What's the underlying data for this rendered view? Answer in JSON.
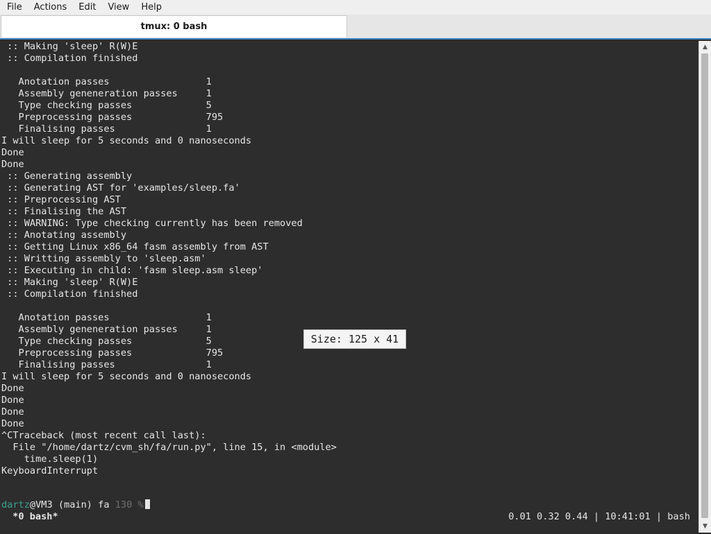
{
  "menu": [
    "File",
    "Actions",
    "Edit",
    "View",
    "Help"
  ],
  "tab": {
    "title": "tmux: 0 bash"
  },
  "terminal": {
    "lines": [
      " :: Making 'sleep' R(W)E",
      " :: Compilation finished",
      "",
      "   Anotation passes                 1",
      "   Assembly geneneration passes     1",
      "   Type checking passes             5",
      "   Preprocessing passes             795",
      "   Finalising passes                1",
      "I will sleep for 5 seconds and 0 nanoseconds",
      "Done",
      "Done",
      " :: Generating assembly",
      " :: Generating AST for 'examples/sleep.fa'",
      " :: Preprocessing AST",
      " :: Finalising the AST",
      " :: WARNING: Type checking currently has been removed",
      " :: Anotating assembly",
      " :: Getting Linux x86_64 fasm assembly from AST",
      " :: Writting assembly to 'sleep.asm'",
      " :: Executing in child: 'fasm sleep.asm sleep'",
      " :: Making 'sleep' R(W)E",
      " :: Compilation finished",
      "",
      "   Anotation passes                 1",
      "   Assembly geneneration passes     1",
      "   Type checking passes             5",
      "   Preprocessing passes             795",
      "   Finalising passes                1",
      "I will sleep for 5 seconds and 0 nanoseconds",
      "Done",
      "Done",
      "Done",
      "Done",
      "^CTraceback (most recent call last):",
      "  File \"/home/dartz/cvm_sh/fa/run.py\", line 15, in <module>",
      "    time.sleep(1)",
      "KeyboardInterrupt"
    ],
    "prompt": {
      "user": "dartz",
      "at": "@",
      "host": "VM3",
      "branch": " (main) fa ",
      "status": "130 %"
    }
  },
  "status_bar": {
    "window": " *0 bash*",
    "right": "0.01 0.32 0.44 | 10:41:01 | bash"
  },
  "tooltip": {
    "text": "Size: 125 x 41"
  },
  "colors": {
    "terminal_bg": "#2d2d2d",
    "terminal_fg": "#e6e6e6",
    "prompt_user": "#3aa38f",
    "frame_accent": "#3d86c6"
  }
}
